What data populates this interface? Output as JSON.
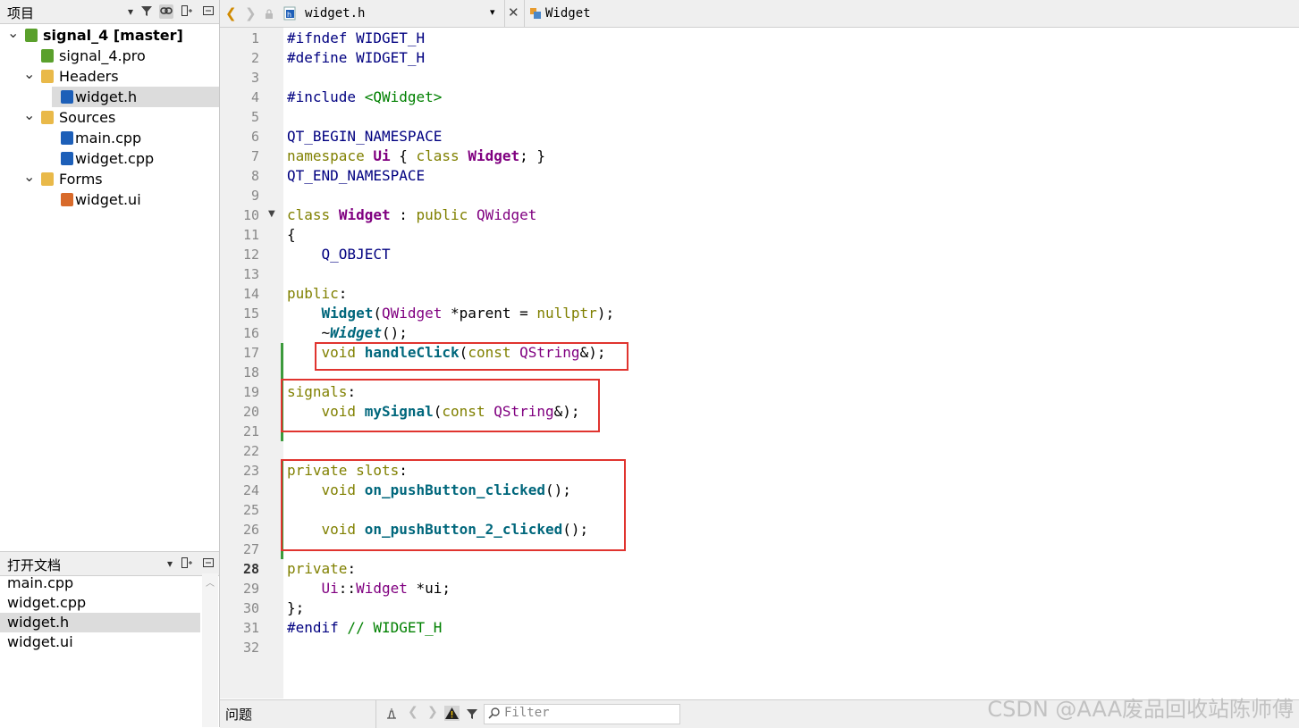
{
  "project_panel": {
    "title": "项目",
    "tree": [
      {
        "label": "signal_4 [master]",
        "level": 0,
        "expanded": true,
        "bold": true,
        "icon": "project-icon"
      },
      {
        "label": "signal_4.pro",
        "level": 1,
        "icon": "pro-file-icon"
      },
      {
        "label": "Headers",
        "level": 1,
        "expanded": true,
        "icon": "headers-folder-icon"
      },
      {
        "label": "widget.h",
        "level": 2,
        "selected": true,
        "icon": "header-file-icon"
      },
      {
        "label": "Sources",
        "level": 1,
        "expanded": true,
        "icon": "sources-folder-icon"
      },
      {
        "label": "main.cpp",
        "level": 2,
        "icon": "cpp-file-icon"
      },
      {
        "label": "widget.cpp",
        "level": 2,
        "icon": "cpp-file-icon"
      },
      {
        "label": "Forms",
        "level": 1,
        "expanded": true,
        "icon": "forms-folder-icon"
      },
      {
        "label": "widget.ui",
        "level": 2,
        "icon": "ui-file-icon"
      }
    ]
  },
  "open_docs_panel": {
    "title": "打开文档",
    "items": [
      {
        "label": "main.cpp"
      },
      {
        "label": "widget.cpp"
      },
      {
        "label": "widget.h",
        "selected": true
      },
      {
        "label": "widget.ui"
      }
    ]
  },
  "editor": {
    "file_name": "widget.h",
    "symbol": "Widget",
    "current_line": 28,
    "line_count": 32
  },
  "code_lines": [
    [
      {
        "t": "#ifndef WIDGET_H",
        "c": "pp"
      }
    ],
    [
      {
        "t": "#define WIDGET_H",
        "c": "pp"
      }
    ],
    [],
    [
      {
        "t": "#include ",
        "c": "pp"
      },
      {
        "t": "<QWidget>",
        "c": "str"
      }
    ],
    [],
    [
      {
        "t": "QT_BEGIN_NAMESPACE",
        "c": "mc"
      }
    ],
    [
      {
        "t": "namespace",
        "c": "kw"
      },
      {
        "t": " "
      },
      {
        "t": "Ui",
        "c": "tyb"
      },
      {
        "t": " { "
      },
      {
        "t": "class",
        "c": "kw"
      },
      {
        "t": " "
      },
      {
        "t": "Widget",
        "c": "tyb"
      },
      {
        "t": "; }"
      }
    ],
    [
      {
        "t": "QT_END_NAMESPACE",
        "c": "mc"
      }
    ],
    [],
    [
      {
        "t": "class",
        "c": "kw"
      },
      {
        "t": " "
      },
      {
        "t": "Widget",
        "c": "tyb"
      },
      {
        "t": " : "
      },
      {
        "t": "public",
        "c": "kw"
      },
      {
        "t": " "
      },
      {
        "t": "QWidget",
        "c": "ty"
      }
    ],
    [
      {
        "t": "{"
      }
    ],
    [
      {
        "t": "    "
      },
      {
        "t": "Q_OBJECT",
        "c": "mc"
      }
    ],
    [],
    [
      {
        "t": "public",
        "c": "kw"
      },
      {
        "t": ":"
      }
    ],
    [
      {
        "t": "    "
      },
      {
        "t": "Widget",
        "c": "fnb"
      },
      {
        "t": "("
      },
      {
        "t": "QWidget",
        "c": "ty"
      },
      {
        "t": " *parent = "
      },
      {
        "t": "nullptr",
        "c": "kw"
      },
      {
        "t": ");"
      }
    ],
    [
      {
        "t": "    ~"
      },
      {
        "t": "Widget",
        "c": "fnbi"
      },
      {
        "t": "();"
      }
    ],
    [
      {
        "t": "    "
      },
      {
        "t": "void",
        "c": "kw"
      },
      {
        "t": " "
      },
      {
        "t": "handleClick",
        "c": "fnb"
      },
      {
        "t": "("
      },
      {
        "t": "const",
        "c": "kw"
      },
      {
        "t": " "
      },
      {
        "t": "QString",
        "c": "ty"
      },
      {
        "t": "&);"
      }
    ],
    [],
    [
      {
        "t": "signals",
        "c": "kw"
      },
      {
        "t": ":"
      }
    ],
    [
      {
        "t": "    "
      },
      {
        "t": "void",
        "c": "kw"
      },
      {
        "t": " "
      },
      {
        "t": "mySignal",
        "c": "fnb"
      },
      {
        "t": "("
      },
      {
        "t": "const",
        "c": "kw"
      },
      {
        "t": " "
      },
      {
        "t": "QString",
        "c": "ty"
      },
      {
        "t": "&);"
      }
    ],
    [],
    [],
    [
      {
        "t": "private",
        "c": "kw"
      },
      {
        "t": " "
      },
      {
        "t": "slots",
        "c": "kw"
      },
      {
        "t": ":"
      }
    ],
    [
      {
        "t": "    "
      },
      {
        "t": "void",
        "c": "kw"
      },
      {
        "t": " "
      },
      {
        "t": "on_pushButton_clicked",
        "c": "fnb"
      },
      {
        "t": "();"
      }
    ],
    [],
    [
      {
        "t": "    "
      },
      {
        "t": "void",
        "c": "kw"
      },
      {
        "t": " "
      },
      {
        "t": "on_pushButton_2_clicked",
        "c": "fnb"
      },
      {
        "t": "();"
      }
    ],
    [],
    [
      {
        "t": "private",
        "c": "kw"
      },
      {
        "t": ":"
      }
    ],
    [
      {
        "t": "    "
      },
      {
        "t": "Ui",
        "c": "ty"
      },
      {
        "t": "::"
      },
      {
        "t": "Widget",
        "c": "ty"
      },
      {
        "t": " *ui;"
      }
    ],
    [
      {
        "t": "};"
      }
    ],
    [
      {
        "t": "#endif",
        "c": "pp"
      },
      {
        "t": " // WIDGET_H",
        "c": "cm"
      }
    ],
    []
  ],
  "issues_panel": {
    "title": "问题",
    "filter_placeholder": "Filter"
  },
  "watermark": "CSDN @AAA废品回收站陈师傅",
  "colors": {
    "highlight_box": "#e0342f",
    "modified_bar": "#3c9a3c",
    "keyword": "#808000",
    "type": "#800080",
    "function": "#00677c",
    "preprocessor": "#000080"
  }
}
